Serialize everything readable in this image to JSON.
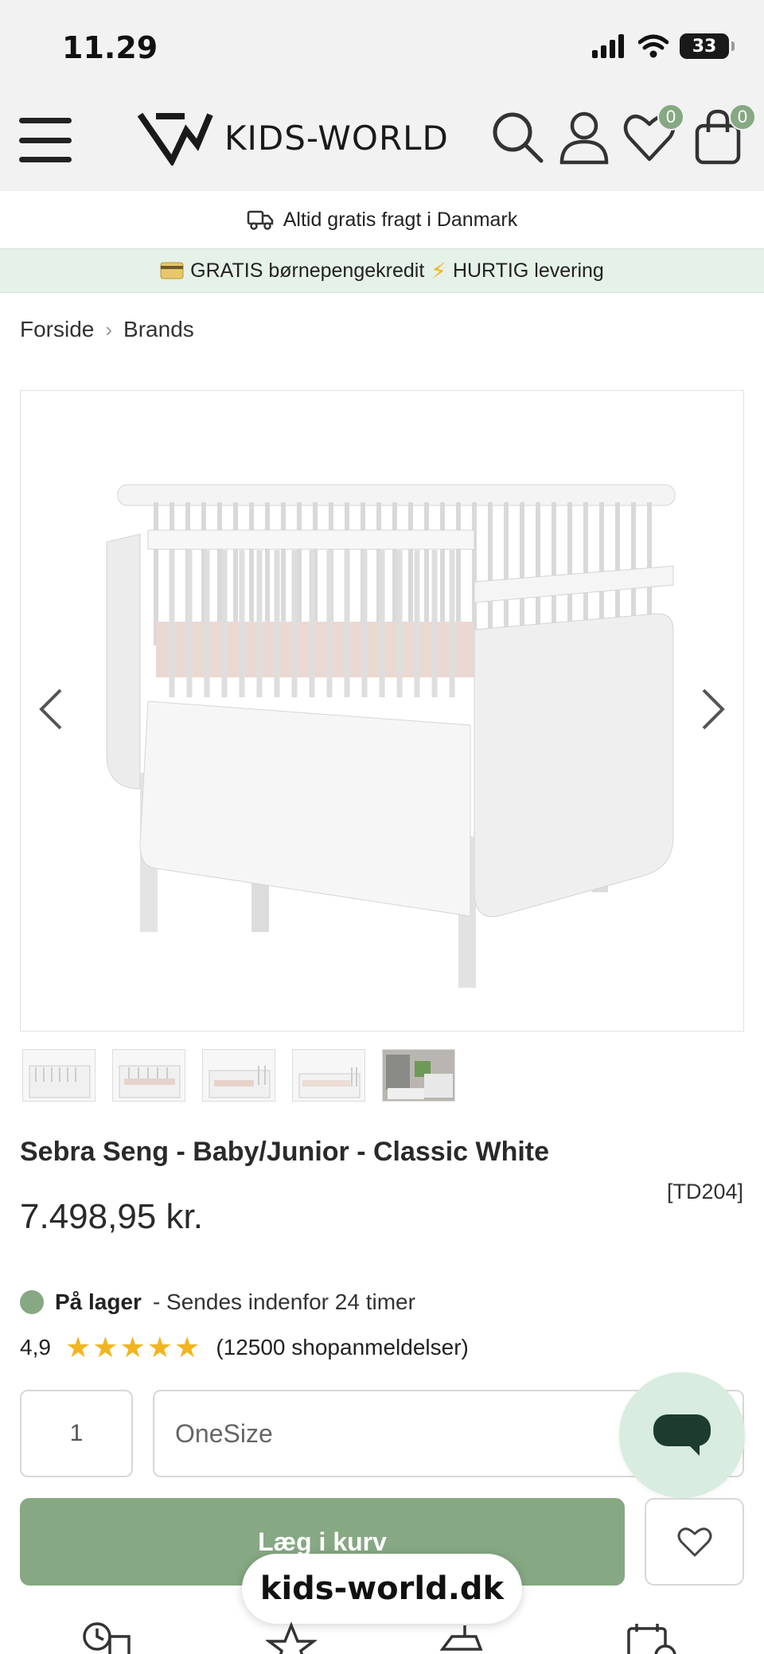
{
  "status_bar": {
    "time": "11.29",
    "battery": "33"
  },
  "header": {
    "logo_text": "KIDS-WORLD",
    "wishlist_count": "0",
    "cart_count": "0",
    "icons": [
      "menu-icon",
      "search-icon",
      "user-icon",
      "heart-icon",
      "bag-icon"
    ]
  },
  "banners": {
    "shipping": "Altid gratis fragt i Danmark",
    "promo_1": "GRATIS børnepengekredit",
    "promo_2": "HURTIG levering"
  },
  "breadcrumb": {
    "items": [
      "Forside",
      "Brands"
    ]
  },
  "product": {
    "title": "Sebra Seng - Baby/Junior - Classic White",
    "sku": "[TD204]",
    "price": "7.498,95 kr.",
    "stock_status": "På lager",
    "stock_note": "- Sendes indenfor 24 timer",
    "rating_value": "4,9",
    "rating_stars": "★★★★★",
    "rating_count": "(12500 shopanmeldelser)",
    "thumbnail_count": 5
  },
  "form": {
    "quantity": "1",
    "size": "OneSize",
    "add_to_cart": "Læg i kurv"
  },
  "browser": {
    "url": "kids-world.dk"
  },
  "colors": {
    "accent_green": "#86a883",
    "promo_bg": "#e6f1e8",
    "chat_bg": "#d8ece0",
    "star_yellow": "#f2b51f"
  }
}
